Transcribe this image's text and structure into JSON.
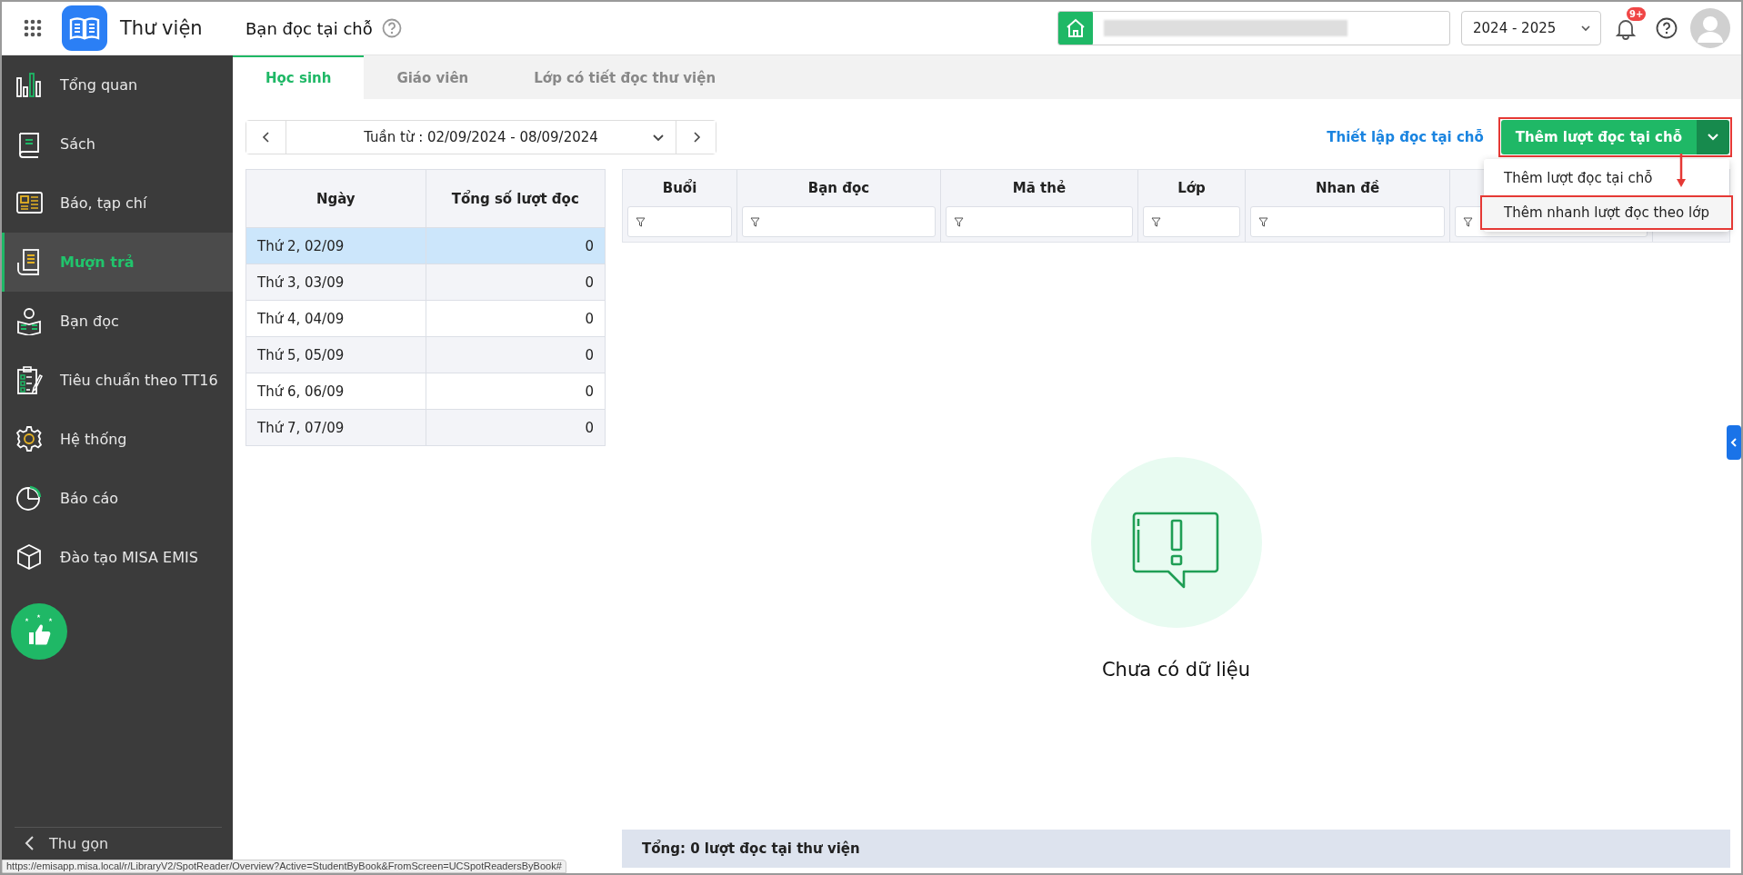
{
  "app": {
    "title": "Thư viện"
  },
  "page": {
    "title": "Bạn đọc tại chỗ"
  },
  "header": {
    "school_year": "2024 - 2025",
    "notification_badge": "9+"
  },
  "sidebar": {
    "items": [
      {
        "label": "Tổng quan",
        "selected": false
      },
      {
        "label": "Sách",
        "selected": false
      },
      {
        "label": "Báo, tạp chí",
        "selected": false
      },
      {
        "label": "Mượn trả",
        "selected": true
      },
      {
        "label": "Bạn đọc",
        "selected": false
      },
      {
        "label": "Tiêu chuẩn theo TT16",
        "selected": false
      },
      {
        "label": "Hệ thống",
        "selected": false
      },
      {
        "label": "Báo cáo",
        "selected": false
      },
      {
        "label": "Đào tạo MISA EMIS",
        "selected": false
      }
    ],
    "collapse": "Thu gọn"
  },
  "tabs": [
    {
      "label": "Học sinh",
      "selected": true
    },
    {
      "label": "Giáo viên",
      "selected": false
    },
    {
      "label": "Lớp có tiết đọc thư viện",
      "selected": false
    }
  ],
  "week_picker": {
    "label": "Tuần từ : 02/09/2024 - 08/09/2024"
  },
  "toolbar": {
    "link": "Thiết lập đọc tại chỗ",
    "primary_button": "Thêm lượt đọc tại chỗ",
    "annotated": true
  },
  "dropdown_menu": {
    "items": [
      {
        "label": "Thêm lượt đọc tại chỗ",
        "annotated": false
      },
      {
        "label": "Thêm nhanh lượt đọc theo lớp",
        "annotated": true
      }
    ]
  },
  "day_table": {
    "columns": [
      "Ngày",
      "Tổng số lượt đọc"
    ],
    "rows": [
      {
        "day": "Thứ 2, 02/09",
        "count": "0",
        "selected": true
      },
      {
        "day": "Thứ 3, 03/09",
        "count": "0",
        "selected": false
      },
      {
        "day": "Thứ 4, 04/09",
        "count": "0",
        "selected": false
      },
      {
        "day": "Thứ 5, 05/09",
        "count": "0",
        "selected": false
      },
      {
        "day": "Thứ 6, 06/09",
        "count": "0",
        "selected": false
      },
      {
        "day": "Thứ 7, 07/09",
        "count": "0",
        "selected": false
      }
    ]
  },
  "detail_table": {
    "columns": [
      {
        "label": "Buổi",
        "filter": true
      },
      {
        "label": "Bạn đọc",
        "filter": true
      },
      {
        "label": "Mã thẻ",
        "filter": true
      },
      {
        "label": "Lớp",
        "filter": true
      },
      {
        "label": "Nhan đề",
        "filter": true
      },
      {
        "filter": true
      },
      {
        "filter": false
      }
    ]
  },
  "empty_state": {
    "message": "Chưa có dữ liệu"
  },
  "footer": {
    "total": "Tổng: 0 lượt đọc tại thư viện"
  },
  "status_url": "https://emisapp.misa.local/r/LibraryV2/SpotReader/Overview?Active=StudentByBook&FromScreen=UCSpotReadersByBook#"
}
